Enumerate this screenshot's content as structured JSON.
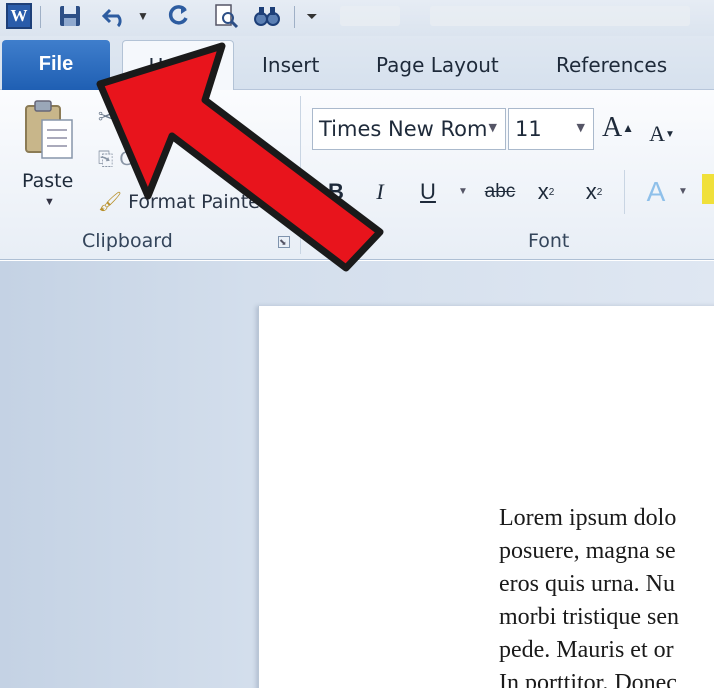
{
  "quick_access": {
    "word_letter": "W",
    "icons": [
      "word-icon",
      "save-icon",
      "undo-icon",
      "redo-icon",
      "print-preview-icon",
      "find-icon",
      "customize-dropdown-icon"
    ]
  },
  "tabs": {
    "file": "File",
    "home": "Home",
    "insert": "Insert",
    "page_layout": "Page Layout",
    "references": "References"
  },
  "clipboard": {
    "paste_label": "Paste",
    "cut_label": "Cut",
    "copy_label": "Copy",
    "format_painter_label": "Format Painter",
    "group_label": "Clipboard"
  },
  "font": {
    "font_name": "Times New Rom",
    "font_size": "11",
    "grow_label": "A",
    "shrink_label": "A",
    "bold_label": "B",
    "italic_label": "I",
    "underline_label": "U",
    "strikethrough_label": "abc",
    "subscript_label": "x",
    "superscript_label": "x",
    "text_effects_label": "A",
    "group_label": "Font"
  },
  "document": {
    "lines": [
      "Lorem ipsum dolo",
      "posuere, magna se",
      "eros quis urna. Nu",
      "morbi tristique sen",
      "pede. Mauris et or",
      "In porttitor. Donec"
    ]
  },
  "colors": {
    "file_tab": "#2a6ac0",
    "annotation_arrow": "#e8141c",
    "workspace": "#cfdbea"
  }
}
